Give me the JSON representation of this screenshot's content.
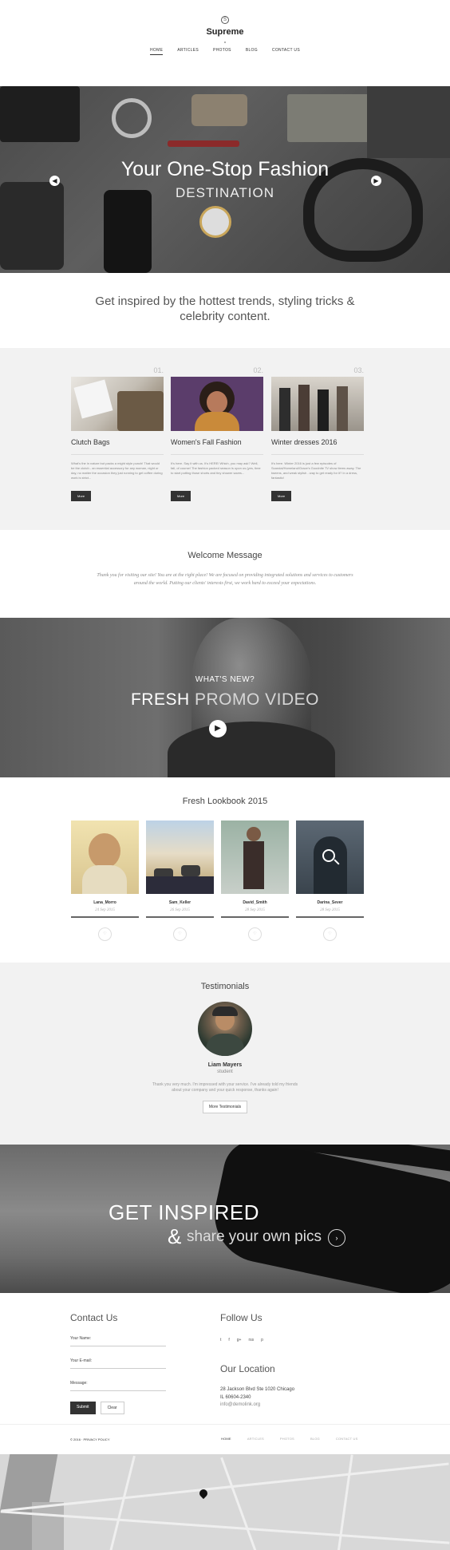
{
  "header": {
    "logo_mark": "S",
    "brand": "Supreme",
    "nav": [
      "HOME",
      "ARTICLES",
      "PHOTOS",
      "BLOG",
      "CONTACT US"
    ]
  },
  "hero": {
    "title": "Your One-Stop Fashion",
    "subtitle": "DESTINATION",
    "prev_icon": "chevron-left-icon",
    "next_icon": "chevron-right-icon"
  },
  "tagline": "Get inspired by the hottest trends, styling tricks & celebrity content.",
  "features": [
    {
      "num": "01.",
      "title": "Clutch Bags",
      "text": "What's the in nature but packs a might style punch! That would be the clutch - an essential accessory for any woman, night or day, no matter the occasion they just running to get coffee during work is strict...",
      "more": "More"
    },
    {
      "num": "02.",
      "title": "Women's Fall Fashion",
      "text": "It's here. Say it with us. It's HERE! Which, you may ask? Well, fall, of course! The fashion packed season is upon us (yes, time to start putting those shorts and tiny shower saves...",
      "more": "More"
    },
    {
      "num": "03.",
      "title": "Winter dresses 2016",
      "text": "It's here. Winter 2016 is just a few episodes of Scandal/Homeland/Grace's Goodnite TV show items away. The tweens, and weak stylish - way to get ready for it? In a dress, fantastic!",
      "more": "More"
    }
  ],
  "welcome": {
    "title": "Welcome Message",
    "text": "Thank you for visiting our site! You are at the right place! We are focused on providing integrated solutions and services to customers around the world. Putting our clients' interests first, we work hard to exceed your expectations."
  },
  "promo": {
    "kicker": "WHAT'S NEW?",
    "title_bold": "FRESH",
    "title_thin": "PROMO VIDEO",
    "play_icon": "play-icon"
  },
  "lookbook": {
    "title": "Fresh Lookbook 2015",
    "items": [
      {
        "name": "Lana_Morro",
        "date": "24 Sep 2015"
      },
      {
        "name": "Sam_Keller",
        "date": "26 Sep 2015"
      },
      {
        "name": "David_Smith",
        "date": "28 Sep 2015"
      },
      {
        "name": "Darina_Sever",
        "date": "28 Sep 2015"
      }
    ]
  },
  "testimonials": {
    "title": "Testimonials",
    "name": "Liam Mayers",
    "role": "student",
    "quote": "Thank you very much. I'm impressed with your service. I've already told my friends about your company and your quick response, thanks again!",
    "button": "More Testimonials"
  },
  "inspired": {
    "line1": "GET INSPIRED",
    "amp": "&",
    "line2": "share your own pics",
    "go_icon": "chevron-right-icon"
  },
  "contact": {
    "title": "Contact Us",
    "name_label": "Your Name:",
    "email_label": "Your E-mail:",
    "message_label": "Message:",
    "submit": "Submit",
    "clear": "Clear"
  },
  "follow": {
    "title": "Follow Us",
    "socials": [
      "t",
      "f",
      "g+",
      "rss",
      "p"
    ]
  },
  "location": {
    "title": "Our Location",
    "address1": "28 Jackson Blvd Ste 1020 Chicago",
    "address2": "IL 60604-2340",
    "email": "info@demolink.org"
  },
  "footer": {
    "copyright": "© 2016 · PRIVACY POLICY",
    "nav": [
      "HOME",
      "ARTICLES",
      "PHOTOS",
      "BLOG",
      "CONTACT US"
    ]
  }
}
